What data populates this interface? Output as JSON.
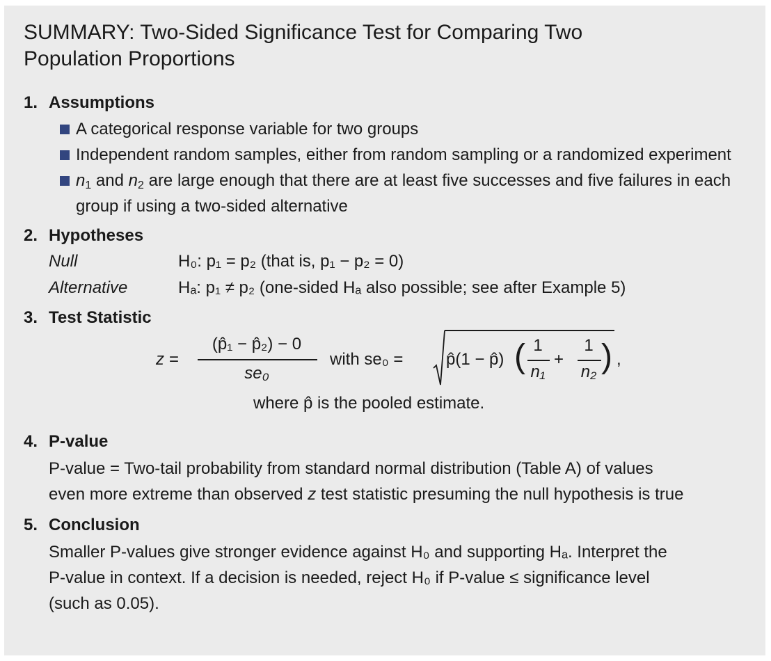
{
  "title": "SUMMARY: Two-Sided Significance Test for Comparing Two Population Proportions",
  "sections": {
    "assumptions": {
      "number": "1.",
      "heading": "Assumptions",
      "bullets": [
        "A categorical response variable for two groups",
        "Independent random samples, either from random sampling or a randomized experiment",
        "are large enough that there are at least five successes and five failures in each group if using a two-sided alternative"
      ],
      "bullet3_prefix": {
        "n1": "n",
        "and": " and ",
        "n2": "n"
      }
    },
    "hypotheses": {
      "number": "2.",
      "heading": "Hypotheses",
      "null_label": "Null",
      "null_text": "H₀: p₁ = p₂ (that is, p₁ − p₂ = 0)",
      "alt_label": "Alternative",
      "alt_text": "Hₐ: p₁ ≠ p₂ (one-sided Hₐ also possible; see after Example 5)"
    },
    "test_statistic": {
      "number": "3.",
      "heading": "Test Statistic",
      "z_lhs": "z =",
      "numerator": "(p̂₁ − p̂₂) − 0",
      "denominator": "se₀",
      "with": "with se₀ =",
      "radicand": "p̂(1 − p̂)",
      "frac1_num": "1",
      "frac1_den": "n₁",
      "plus": "+",
      "frac2_num": "1",
      "frac2_den": "n₂",
      "comma": ",",
      "where": "where p̂ is the pooled estimate."
    },
    "pvalue": {
      "number": "4.",
      "heading": "P-value",
      "text_line1": "P-value = Two-tail probability from standard normal distribution (Table A) of values",
      "text_line2a": "even more extreme than observed ",
      "text_line2z": "z",
      "text_line2b": " test statistic presuming the null hypothesis is true"
    },
    "conclusion": {
      "number": "5.",
      "heading": "Conclusion",
      "line1": "Smaller P-values give stronger evidence against H₀ and supporting Hₐ. Interpret the",
      "line2": "P-value in context. If a decision is needed, reject H₀ if P-value ≤ significance level",
      "line3": "(such as 0.05)."
    }
  },
  "colors": {
    "panel": "#ebebeb",
    "bullet": "#32457f"
  }
}
